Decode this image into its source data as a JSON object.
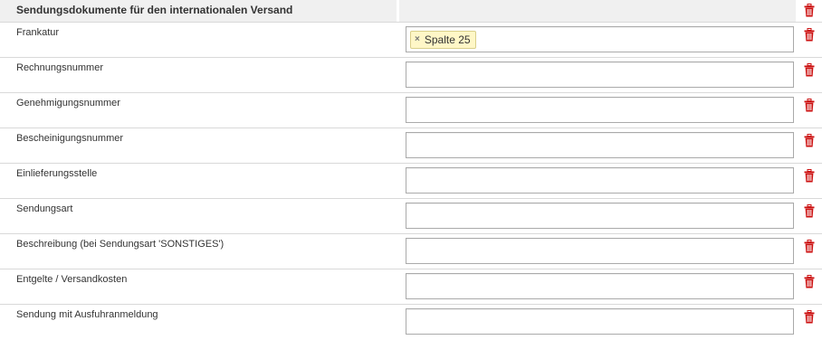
{
  "section": {
    "title": "Sendungsdokumente für den internationalen Versand"
  },
  "rows": [
    {
      "label": "Frankatur",
      "token": "Spalte 25"
    },
    {
      "label": "Rechnungsnummer"
    },
    {
      "label": "Genehmigungsnummer"
    },
    {
      "label": "Bescheinigungsnummer"
    },
    {
      "label": "Einlieferungsstelle"
    },
    {
      "label": "Sendungsart"
    },
    {
      "label": "Beschreibung (bei Sendungsart 'SONSTIGES')"
    },
    {
      "label": "Entgelte / Versandkosten"
    },
    {
      "label": "Sendung mit Ausfuhranmeldung"
    }
  ],
  "token_remove_symbol": "×",
  "icons": {
    "delete": "trash-icon",
    "token_remove": "close-icon"
  },
  "colors": {
    "delete_icon": "#cc1111",
    "token_bg": "#fff7c7",
    "header_bg": "#f0f0f0"
  }
}
